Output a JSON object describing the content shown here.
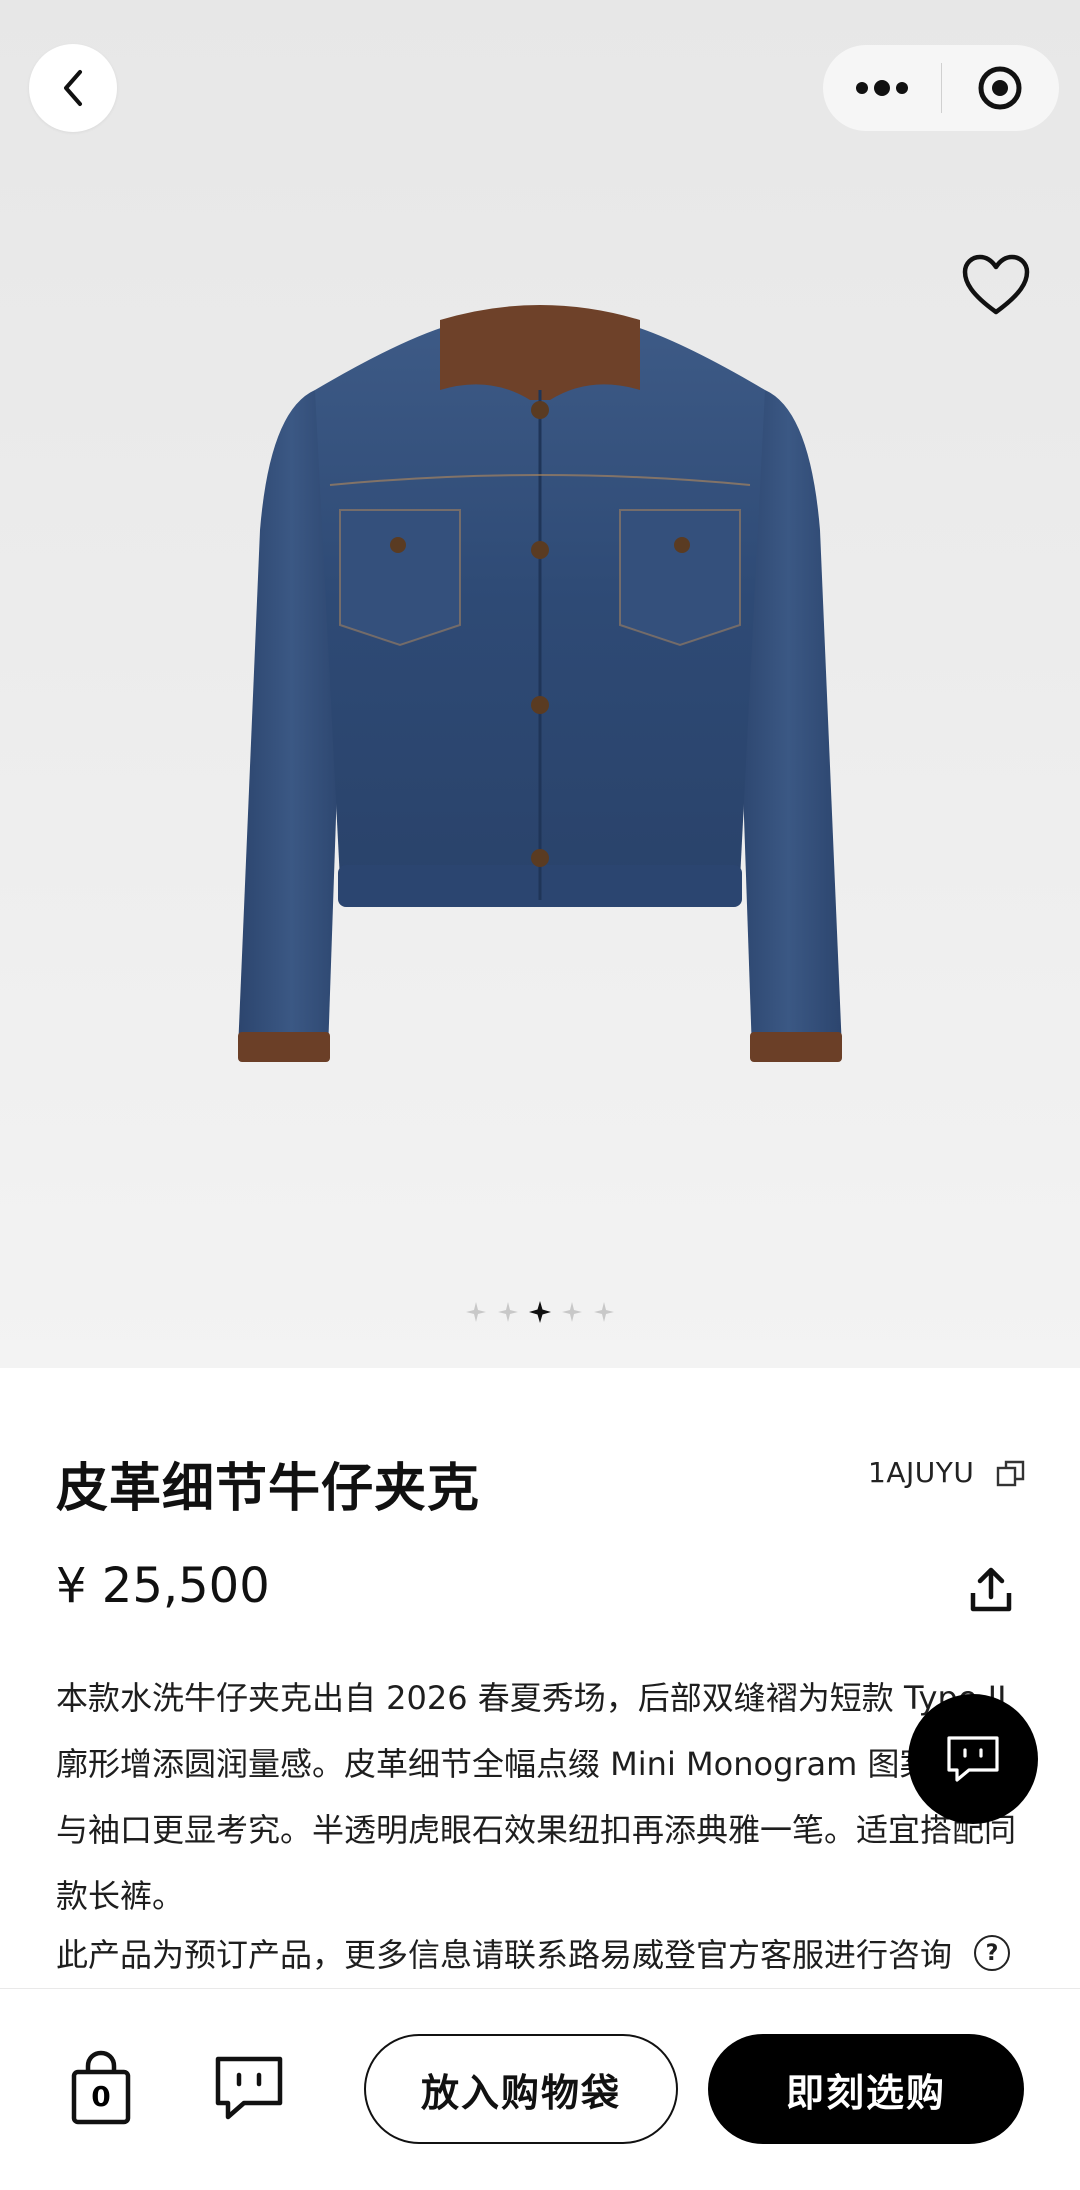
{
  "product": {
    "title": "皮革细节牛仔夹克",
    "sku": "1AJUYU",
    "price": "¥ 25,500",
    "description": "本款水洗牛仔夹克出自 2026 春夏秀场，后部双缝褶为短款 Type II 廓形增添圆润量感。皮革细节全幅点缀 Mini Monogram 图案，翻领与袖口更显考究。半透明虎眼石效果纽扣再添典雅一笔。适宜搭配同款长裤。",
    "preorder_note": "此产品为预订产品，更多信息请联系路易威登官方客服进行咨询",
    "help_icon_text": "?"
  },
  "gallery": {
    "total_images": 5,
    "active_index": 2
  },
  "bottom_bar": {
    "bag_count": "0",
    "add_to_bag_label": "放入购物袋",
    "buy_now_label": "即刻选购"
  },
  "icons": {
    "back": "chevron-left-icon",
    "more": "more-dots-icon",
    "close_miniprogram": "target-circle-icon",
    "favorite": "heart-icon",
    "copy": "copy-icon",
    "share": "share-upload-icon",
    "chat": "chat-bubble-icon",
    "bag": "shopping-bag-icon",
    "message": "message-icon",
    "gallery_dot": "star-dot-icon"
  },
  "colors": {
    "primary_button": "#000000",
    "hero_background": "#ececec",
    "text": "#1a1a1a"
  }
}
